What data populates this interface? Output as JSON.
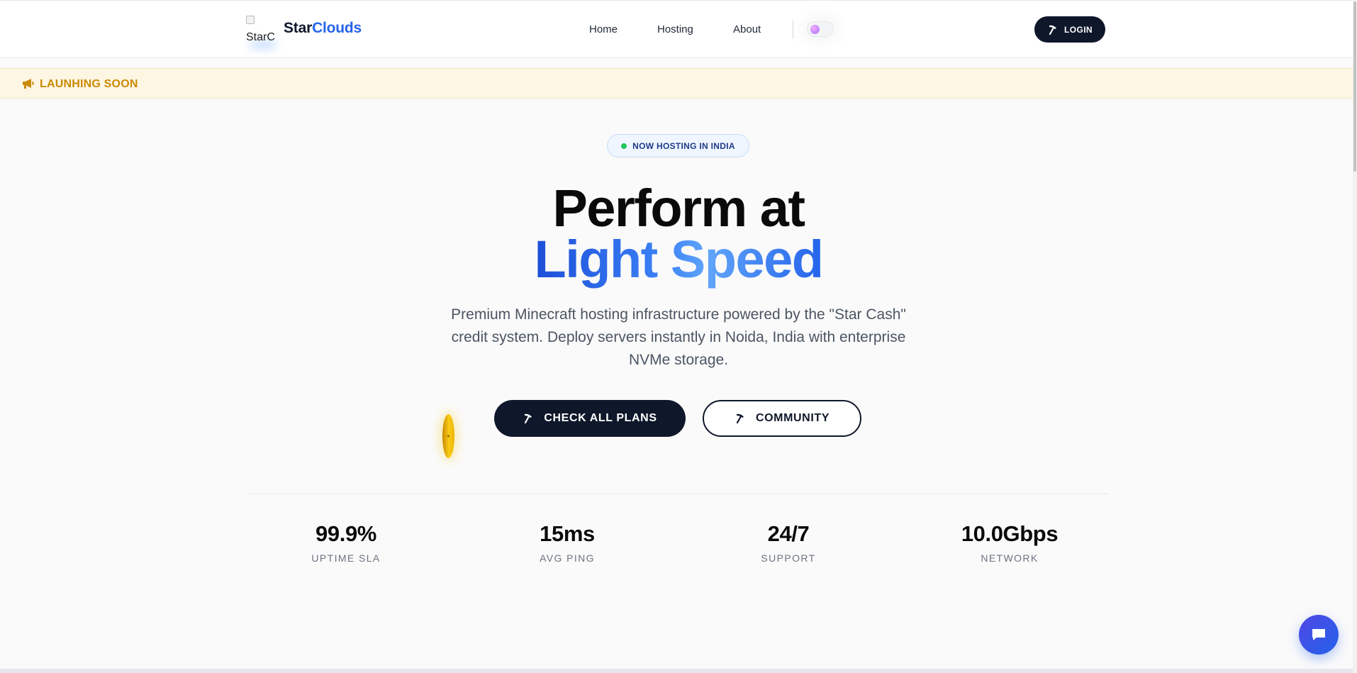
{
  "brand": {
    "logo_alt": "StarC",
    "name_part1": "Star",
    "name_part2": "Clouds",
    "accent": "#2563eb"
  },
  "nav": {
    "items": [
      {
        "label": "Home"
      },
      {
        "label": "Hosting"
      },
      {
        "label": "About"
      }
    ],
    "login_label": "LOGIN",
    "theme_toggle": "off"
  },
  "announcement": {
    "icon": "megaphone-icon",
    "text": "LAUNHING SOON",
    "color": "#ca8a04"
  },
  "hero": {
    "badge": "NOW HOSTING IN INDIA",
    "title_line1": "Perform at",
    "title_line2": "Light Speed",
    "description": "Premium Minecraft hosting infrastructure powered by the \"Star Cash\" credit system. Deploy servers instantly in Noida, India with enterprise NVMe storage.",
    "primary_cta": "CHECK ALL PLANS",
    "secondary_cta": "COMMUNITY"
  },
  "stats": [
    {
      "value": "99.9%",
      "label": "UPTIME SLA"
    },
    {
      "value": "15ms",
      "label": "AVG PING"
    },
    {
      "value": "24/7",
      "label": "SUPPORT"
    },
    {
      "value": "10.0Gbps",
      "label": "NETWORK"
    }
  ],
  "chat": {
    "icon": "chat-bubble-icon"
  }
}
